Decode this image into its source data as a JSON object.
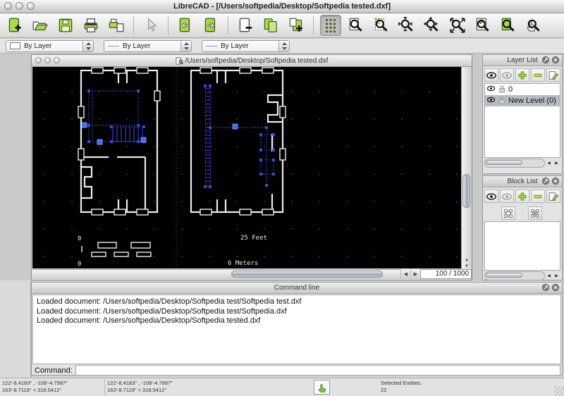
{
  "window": {
    "title": "LibreCAD - [/Users/softpedia/Desktop/Softpedia tested.dxf]"
  },
  "main_toolbar": {
    "buttons": [
      {
        "name": "new-file",
        "glyph": "new"
      },
      {
        "name": "open-file",
        "glyph": "open"
      },
      {
        "name": "save-file",
        "glyph": "save"
      },
      {
        "name": "print",
        "glyph": "print"
      },
      {
        "name": "print-preview",
        "glyph": "printprev"
      },
      {
        "sep": true
      },
      {
        "name": "selection-pointer",
        "glyph": "pointer"
      },
      {
        "sep": true
      },
      {
        "name": "undo",
        "glyph": "undo"
      },
      {
        "name": "redo",
        "glyph": "redo"
      },
      {
        "sep": true
      },
      {
        "name": "cut",
        "glyph": "cut"
      },
      {
        "name": "copy",
        "glyph": "copy"
      },
      {
        "name": "paste",
        "glyph": "paste"
      },
      {
        "sep": true
      },
      {
        "name": "grid-toggle",
        "glyph": "grid",
        "pressed": true
      },
      {
        "name": "redraw",
        "glyph": "redraw"
      },
      {
        "name": "zoom-window",
        "glyph": "zoomwin"
      },
      {
        "name": "zoom-in",
        "glyph": "zoomin"
      },
      {
        "name": "zoom-out",
        "glyph": "zoomout"
      },
      {
        "name": "auto-zoom",
        "glyph": "autozoom"
      },
      {
        "name": "zoom-previous",
        "glyph": "zoomprev"
      },
      {
        "name": "zoom-selected",
        "glyph": "zoomsel"
      },
      {
        "name": "zoom-pan",
        "glyph": "zoompan"
      }
    ]
  },
  "option_bar": {
    "pen_color": "By Layer",
    "pen_width": "By Layer",
    "pen_linetype": "By Layer"
  },
  "left_palette": {
    "tools": [
      {
        "name": "points",
        "glyph": "points"
      },
      {
        "name": "line",
        "glyph": "lineg"
      },
      {
        "name": "arc",
        "glyph": "arc"
      },
      {
        "name": "circle",
        "glyph": "circleg"
      },
      {
        "name": "ellipse",
        "glyph": "ellipseg"
      },
      {
        "name": "spline",
        "glyph": "spline"
      },
      {
        "name": "polyline",
        "glyph": "polyline"
      },
      {
        "name": "empty-slot",
        "glyph": "blank"
      },
      {
        "name": "text",
        "glyph": "textg"
      },
      {
        "name": "dimension",
        "glyph": "dim"
      },
      {
        "name": "hatch",
        "glyph": "hatch"
      },
      {
        "name": "image",
        "glyph": "imageg"
      },
      {
        "name": "modify",
        "glyph": "modify"
      },
      {
        "name": "info",
        "glyph": "infog"
      },
      {
        "name": "construction",
        "glyph": "construction"
      },
      {
        "name": "select",
        "glyph": "selectg"
      }
    ]
  },
  "document_window": {
    "path": "/Users/softpedia/Desktop/Softpedia tested.dxf",
    "zoom_ratio": "100 / 1000"
  },
  "canvas_text": {
    "scale_zero_top": "0",
    "scale_zero_bottom": "0",
    "scale_feet_label": "25 Feet",
    "scale_meters_label": "6 Meters"
  },
  "layer_list": {
    "title": "Layer List",
    "buttons": [
      {
        "name": "show-all-layers",
        "glyph": "eye"
      },
      {
        "name": "hide-all-layers",
        "glyph": "eye_gray"
      },
      {
        "name": "add-layer",
        "glyph": "plus"
      },
      {
        "name": "remove-layer",
        "glyph": "minus"
      },
      {
        "name": "edit-layer",
        "glyph": "edit"
      }
    ],
    "layers": [
      {
        "name": "0",
        "selected": false
      },
      {
        "name": "New Level (0)",
        "selected": true
      }
    ]
  },
  "block_list": {
    "title": "Block List",
    "buttons_row1": [
      {
        "name": "show-all-blocks",
        "glyph": "eye"
      },
      {
        "name": "hide-all-blocks",
        "glyph": "eye_gray"
      },
      {
        "name": "add-block",
        "glyph": "plus"
      },
      {
        "name": "remove-block",
        "glyph": "minus"
      },
      {
        "name": "edit-block-attributes",
        "glyph": "edit"
      }
    ],
    "buttons_row2": [
      {
        "name": "edit-block",
        "glyph": "frame"
      },
      {
        "name": "insert-block",
        "glyph": "framex"
      }
    ],
    "blocks": []
  },
  "command_panel": {
    "title": "Command line",
    "history": [
      "Loaded document: /Users/softpedia/Desktop/Softpedia test/Softpedia test.dxf",
      "Loaded document: /Users/softpedia/Desktop/Softpedia test/Softpedia.dxf",
      "Loaded document: /Users/softpedia/Desktop/Softpedia tested.dxf"
    ],
    "prompt_label": "Command:",
    "input_value": ""
  },
  "status_bar": {
    "absolute_coords_line1": "122'-8.4183\" , -108'-4.7987\"",
    "absolute_coords_line2": "163'-8.7119\" < 318.5412°",
    "relative_coords_line1": "122'-8.4183\" , -108'-4.7987\"",
    "relative_coords_line2": "163'-8.7119\" < 318.5412°",
    "selected_entities_label": "Selected Entities:",
    "selected_entities_count": "22"
  },
  "colors": {
    "icon_green": "#a8d94e",
    "selection_blue": "#3a46e0",
    "canvas_bg": "#000000"
  }
}
